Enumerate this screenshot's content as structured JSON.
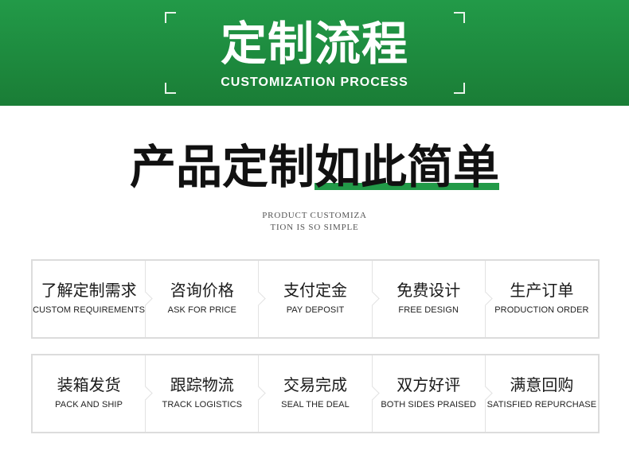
{
  "banner": {
    "title": "定制流程",
    "subtitle": "CUSTOMIZATION PROCESS"
  },
  "headline": {
    "part1": "产品定制",
    "part2": "如此简单",
    "sub_line1": "PRODUCT CUSTOMIZA",
    "sub_line2": "TION IS SO SIMPLE"
  },
  "steps_row1": [
    {
      "cn": "了解定制需求",
      "en": "CUSTOM REQUIREMENTS"
    },
    {
      "cn": "咨询价格",
      "en": "ASK FOR PRICE"
    },
    {
      "cn": "支付定金",
      "en": "PAY DEPOSIT"
    },
    {
      "cn": "免费设计",
      "en": "FREE DESIGN"
    },
    {
      "cn": "生产订单",
      "en": "PRODUCTION ORDER"
    }
  ],
  "steps_row2": [
    {
      "cn": "装箱发货",
      "en": "PACK AND SHIP"
    },
    {
      "cn": "跟踪物流",
      "en": "TRACK LOGISTICS"
    },
    {
      "cn": "交易完成",
      "en": "SEAL THE DEAL"
    },
    {
      "cn": "双方好评",
      "en": "BOTH SIDES PRAISED"
    },
    {
      "cn": "满意回购",
      "en": "SATISFIED REPURCHASE"
    }
  ],
  "colors": {
    "brand_green": "#229a48",
    "border_gray": "#dcdcdc"
  }
}
